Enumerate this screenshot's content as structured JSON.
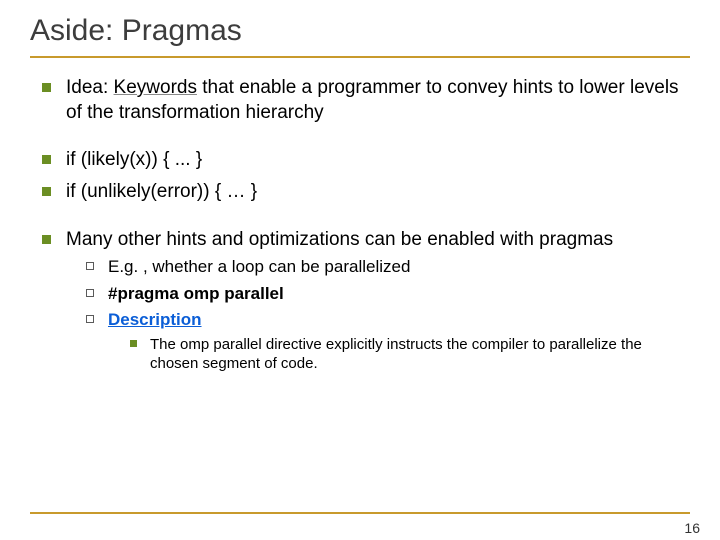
{
  "title": "Aside: Pragmas",
  "bullets": {
    "idea_prefix": "Idea: ",
    "idea_keyword": "Keywords",
    "idea_rest": " that enable a programmer to convey hints to lower levels of the transformation hierarchy",
    "code1": "if (likely(x)) { ... }",
    "code2": "if (unlikely(error)) { … }",
    "hints": "Many other hints and optimizations can be enabled with pragmas",
    "sub": {
      "parallel": "E.g. , whether a loop can be parallelized",
      "pragma": "#pragma omp parallel",
      "desc_link": "Description",
      "desc_detail": "The omp parallel directive explicitly instructs the compiler to parallelize the chosen segment of code."
    }
  },
  "page_number": "16"
}
